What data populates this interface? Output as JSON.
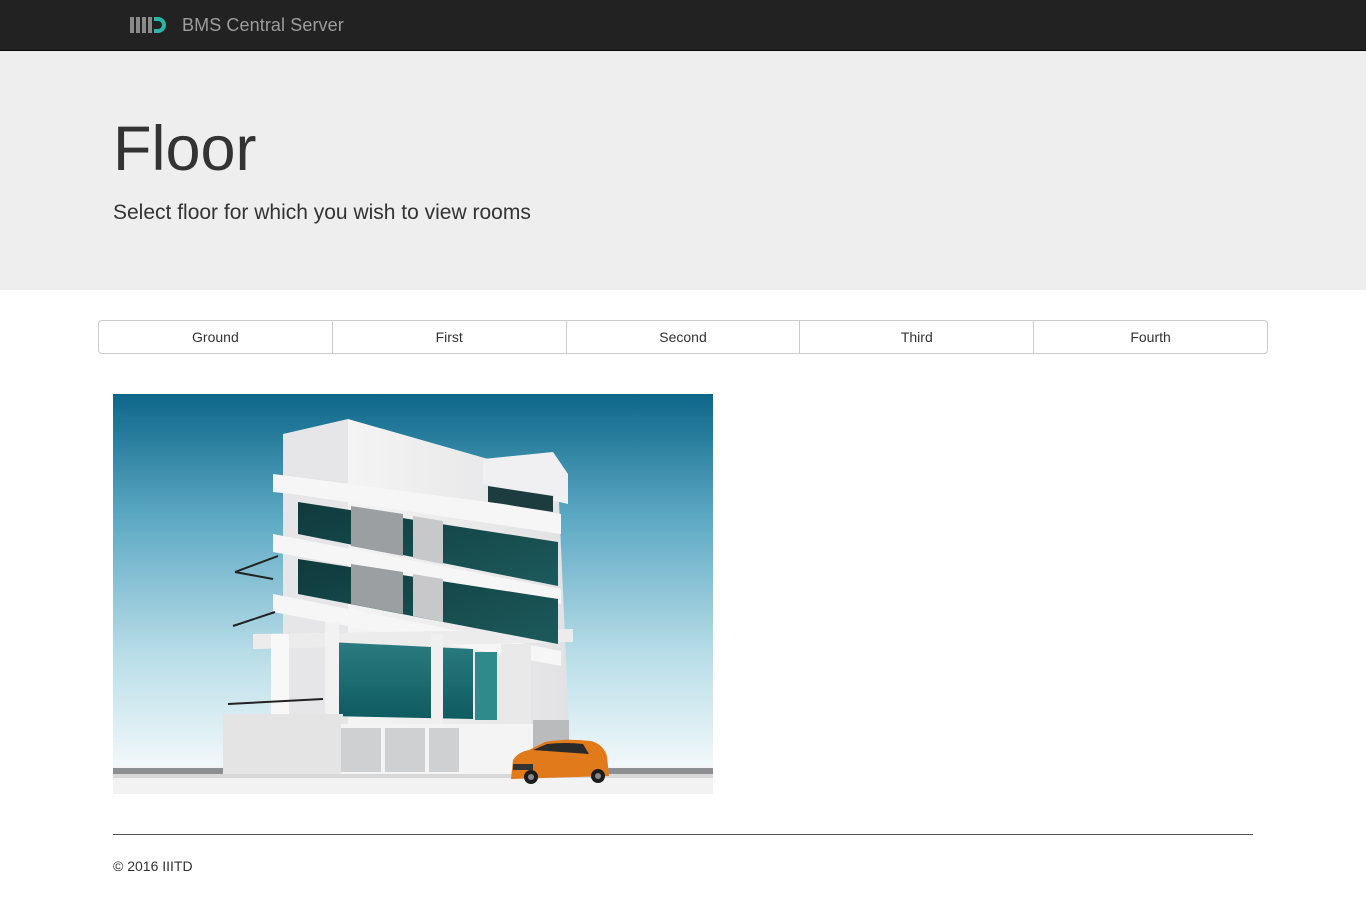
{
  "navbar": {
    "brand_logo": "iiitd-logo",
    "brand_name": "BMS Central Server",
    "background": "#222222",
    "brand_color": "#9d9d9d"
  },
  "jumbotron": {
    "title": "Floor",
    "subtitle": "Select floor for which you wish to view rooms",
    "background": "#eeeeee"
  },
  "floors": [
    {
      "label": "Ground"
    },
    {
      "label": "First"
    },
    {
      "label": "Second"
    },
    {
      "label": "Third"
    },
    {
      "label": "Fourth"
    }
  ],
  "main_image": {
    "subject": "modern white multi-storey building with orange car",
    "accent_sky": "#1a6f8f",
    "accent_car": "#e07a1a"
  },
  "footer": {
    "copyright": "© 2016 IIITD"
  }
}
